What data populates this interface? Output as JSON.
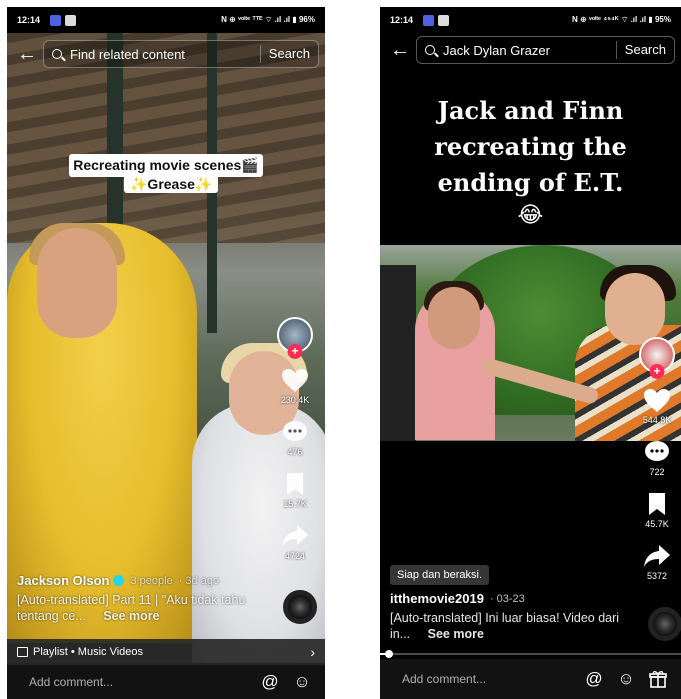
{
  "left": {
    "status": {
      "time": "12:14",
      "right": "N ⊕ ᵛᵒˡᵗᵉ ᵀᵀᴱ ⌔ .ıl .ıl ▮ 96%",
      "badge_colors": [
        "#4f63e0",
        "#dcdcdc"
      ]
    },
    "search": {
      "back_icon": "arrow-left-icon",
      "placeholder": "Find related content",
      "button": "Search"
    },
    "caption": {
      "line1": "Recreating movie scenes🎬",
      "line2": "✨Grease✨"
    },
    "actions": {
      "likes": "230.4K",
      "comments": "476",
      "saves": "15.7K",
      "shares": "4724"
    },
    "author": {
      "name": "Jackson Olson",
      "people": "3 people",
      "age": "· 3d ago"
    },
    "description": {
      "text": "[Auto-translated] Part 11 | \"Aku tidak tahu tentang ce...",
      "see_more": "See more"
    },
    "playlist": {
      "label": "Playlist • Music Videos",
      "icon": "playlist-icon"
    },
    "comment_bar": {
      "placeholder": "Add comment...",
      "icons": [
        "at-icon",
        "emoji-icon"
      ]
    }
  },
  "right": {
    "status": {
      "time": "12:14",
      "right": "N ⊕ ᵛᵒˡᵗᵉ ⁴⁵⁴ᴷ ⌔ .ıl .ıl ▮ 95%"
    },
    "search": {
      "back_icon": "arrow-left-icon",
      "value": "Jack Dylan Grazer",
      "button": "Search"
    },
    "title": {
      "line1": "Jack and Finn",
      "line2": "recreating the",
      "line3": "ending of E.T.",
      "emoji": "😂"
    },
    "actions": {
      "likes": "544.8K",
      "comments": "722",
      "saves": "45.7K",
      "shares": "5372"
    },
    "tag": "Siap dan beraksi.",
    "author": {
      "name": "itthemovie2019",
      "date": "· 03-23"
    },
    "description": {
      "text": "[Auto-translated] Ini luar biasa! Video dari in...",
      "see_more": "See more"
    },
    "progress": 0.03,
    "comment_bar": {
      "placeholder": "Add comment...",
      "icons": [
        "at-icon",
        "emoji-icon",
        "gift-icon"
      ]
    }
  },
  "colors": {
    "like_red": "#fe2c55",
    "verified": "#20d5ec",
    "background": "#000000"
  }
}
